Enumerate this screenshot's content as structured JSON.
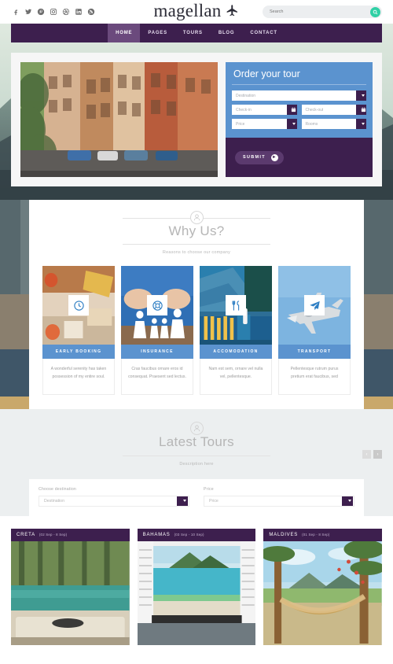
{
  "topbar": {
    "social": [
      {
        "name": "facebook-icon",
        "glyph": "f"
      },
      {
        "name": "twitter-icon",
        "glyph": "t"
      },
      {
        "name": "pinterest-icon",
        "glyph": "p"
      },
      {
        "name": "instagram-icon",
        "glyph": "i"
      },
      {
        "name": "dribbble-icon",
        "glyph": "d"
      },
      {
        "name": "linkedin-icon",
        "glyph": "in"
      },
      {
        "name": "rss-icon",
        "glyph": "r"
      }
    ],
    "brand": "magellan",
    "search": {
      "placeholder": "Search",
      "value": ""
    }
  },
  "nav": {
    "items": [
      {
        "label": "HOME",
        "active": true
      },
      {
        "label": "PAGES",
        "active": false
      },
      {
        "label": "TOURS",
        "active": false
      },
      {
        "label": "BLOG",
        "active": false
      },
      {
        "label": "CONTACT",
        "active": false
      }
    ]
  },
  "order": {
    "title": "Order your tour",
    "destination": "Destination",
    "checkin": "Check-in",
    "checkout": "Check-out",
    "price": "Price",
    "rooms": "Rooms",
    "submit_label": "SUBMIT"
  },
  "whyus": {
    "title": "Why Us?",
    "subtitle": "Reasons to choose our company",
    "cards": [
      {
        "label": "EARLY BOOKING",
        "icon": "clock-icon",
        "text": "A wonderful serenity has taken possession of my entire soul."
      },
      {
        "label": "INSURANCE",
        "icon": "life-ring-icon",
        "text": "Cras faucibus ornare eros id consequat. Praesent sed lectus."
      },
      {
        "label": "ACCOMODATION",
        "icon": "cutlery-icon",
        "text": "Nam est sem, ornare vel nulla vel, pellentesque."
      },
      {
        "label": "TRANSPORT",
        "icon": "paper-plane-icon",
        "text": "Pellentesque rutrum purus pretium erat faucibus, sed"
      }
    ]
  },
  "latest": {
    "title": "Latest Tours",
    "subtitle": "Description here",
    "prev_label": "‹",
    "next_label": "›",
    "filters": {
      "destination_label": "Choose destination",
      "destination_value": "Destination",
      "price_label": "Price",
      "price_value": "Price"
    },
    "tours": [
      {
        "name": "CRETA",
        "dates": "(02 Sep - 8 Sep)"
      },
      {
        "name": "BAHAMAS",
        "dates": "(03 Sep - 10 Sep)"
      },
      {
        "name": "MALDIVES",
        "dates": "(01 Sep - 8 Sep)"
      }
    ]
  },
  "colors": {
    "purple": "#3d1f4e",
    "purple_light": "#6b4a7d",
    "blue": "#5b93cf",
    "teal": "#2fd0a5",
    "gray_bg": "#eceff0"
  }
}
